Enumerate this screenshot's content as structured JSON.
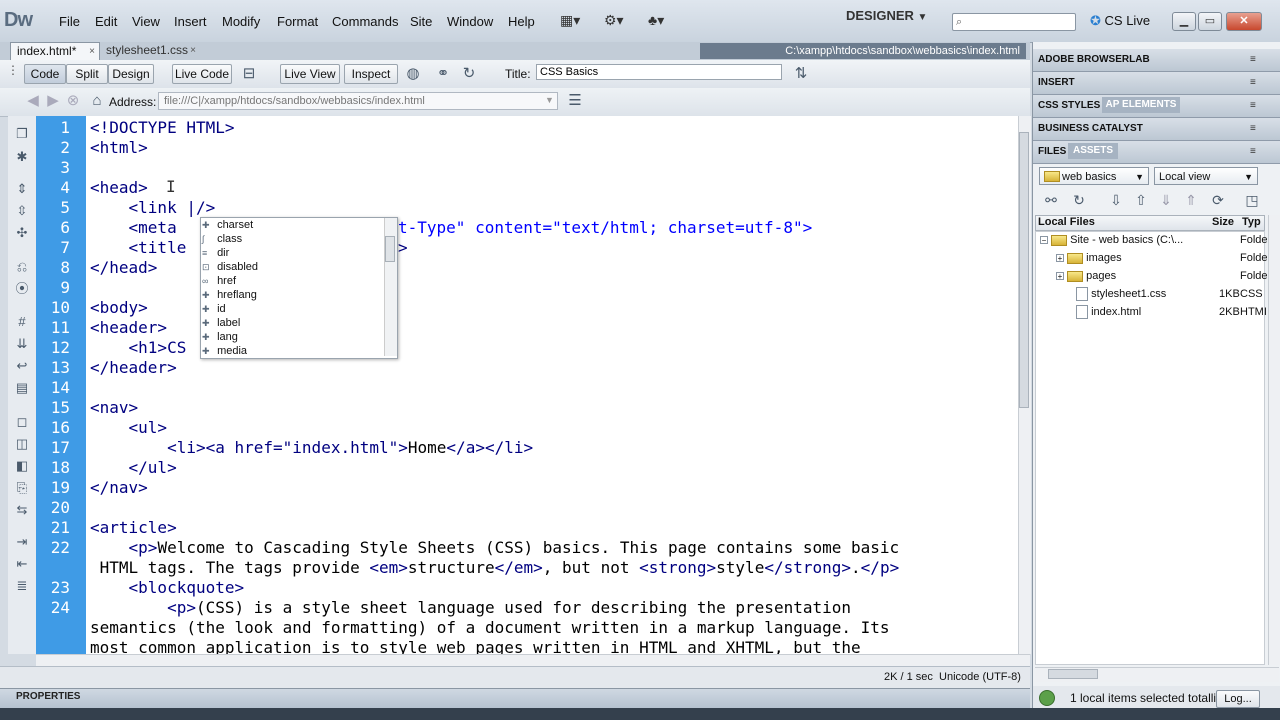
{
  "app": {
    "logo": "Dw",
    "menu": [
      "File",
      "Edit",
      "View",
      "Insert",
      "Modify",
      "Format",
      "Commands",
      "Site",
      "Window",
      "Help"
    ],
    "workspace": "DESIGNER",
    "cslive": "CS Live"
  },
  "tabs": [
    {
      "label": "index.html*",
      "active": true
    },
    {
      "label": "stylesheet1.css",
      "active": false
    }
  ],
  "doc_path": "C:\\xampp\\htdocs\\sandbox\\webbasics\\index.html",
  "toolbar": {
    "code": "Code",
    "split": "Split",
    "design": "Design",
    "live_code": "Live Code",
    "live_view": "Live View",
    "inspect": "Inspect",
    "title_label": "Title:",
    "title_value": "CSS Basics"
  },
  "address": {
    "label": "Address:",
    "value": "file:///C|/xampp/htdocs/sandbox/webbasics/index.html"
  },
  "code": {
    "line_numbers": [
      "1",
      "2",
      "3",
      "4",
      "5",
      "6",
      "7",
      "8",
      "9",
      "10",
      "11",
      "12",
      "13",
      "14",
      "15",
      "16",
      "17",
      "18",
      "19",
      "",
      "20",
      "21",
      "22",
      "",
      "23",
      "24",
      "",
      ""
    ],
    "l1": "<!DOCTYPE HTML>",
    "l2": "<html>",
    "l4": "<head>",
    "l5": "    <link |/>",
    "l6a": "    <meta ",
    "l6b": "t-Type\" content=\"text/html; charset=utf-8\">",
    "l7a": "    <title",
    "l7b": ">",
    "l8": "</head>",
    "l10": "<body>",
    "l11": "<header>",
    "l12": "    <h1>CS",
    "l13": "</header>",
    "l15": "<nav>",
    "l16": "    <ul>",
    "l17a": "        <li><a href=\"index.html\">",
    "l17b": "Home",
    "l17c": "</a></li>",
    "l18": "    </ul>",
    "l19": "</nav>",
    "l21": "<article>",
    "l22a": "    <p>",
    "l22b": "Welcome to Cascading Style Sheets (CSS) basics. This page contains some basic",
    "l22c": " HTML tags. The tags provide ",
    "l22d": "<em>",
    "l22e": "structure",
    "l22f": "</em>",
    "l22g": ", but not ",
    "l22h": "<strong>",
    "l22i": "style",
    "l22j": "</strong>",
    "l22k": ".",
    "l22l": "</p>",
    "l23": "    <blockquote>",
    "l24a": "        <p>",
    "l24b": "(CSS) is a style sheet language used for describing the presentation",
    "l24c": "semantics (the look and formatting) of a document written in a markup language. Its",
    "l24d": "most common application is to style web pages written in HTML and XHTML, but the"
  },
  "code_hint": [
    "charset",
    "class",
    "dir",
    "disabled",
    "href",
    "hreflang",
    "id",
    "label",
    "lang",
    "media"
  ],
  "status": {
    "size": "2K / 1 sec",
    "encoding": "Unicode (UTF-8)"
  },
  "properties_label": "PROPERTIES",
  "panels": {
    "browserlab": "ADOBE BROWSERLAB",
    "insert": "INSERT",
    "css_styles": "CSS STYLES",
    "ap_elements": "AP ELEMENTS",
    "business_catalyst": "BUSINESS CATALYST",
    "files": "FILES",
    "assets": "ASSETS"
  },
  "files": {
    "site": "web basics",
    "view": "Local view",
    "col_local": "Local Files",
    "col_size": "Size",
    "col_type": "Typ",
    "rows": [
      {
        "name": "Site - web basics (C:\\...",
        "size": "",
        "type": "Folde"
      },
      {
        "name": "images",
        "size": "",
        "type": "Folde"
      },
      {
        "name": "pages",
        "size": "",
        "type": "Folde"
      },
      {
        "name": "stylesheet1.css",
        "size": "1KB",
        "type": "CSS"
      },
      {
        "name": "index.html",
        "size": "2KB",
        "type": "HTMI"
      }
    ],
    "status": "1 local items selected totalli",
    "log": "Log..."
  },
  "colors": {
    "gutter": "#3f9be6",
    "tag": "#000080",
    "value": "#0000ff"
  }
}
